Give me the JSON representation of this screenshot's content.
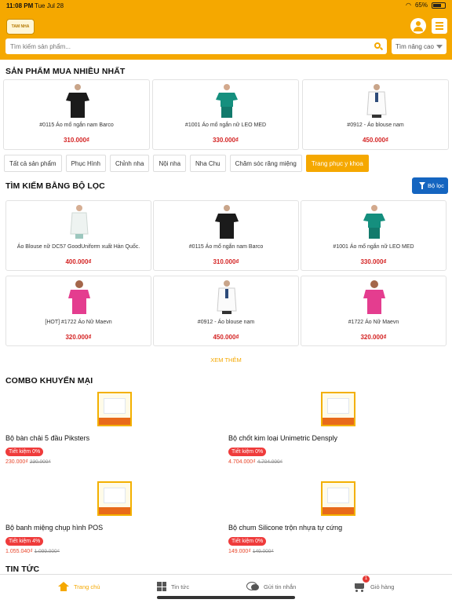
{
  "status_bar": {
    "time": "11:08 PM",
    "date": "Tue Jul 28",
    "battery": "65%"
  },
  "header": {
    "logo_text": "TAM NHA",
    "search_placeholder": "Tìm kiếm sản phẩm...",
    "advanced_label": "Tìm nâng cao"
  },
  "best_sellers": {
    "title": "SẢN PHẨM MUA NHIỀU NHẤT",
    "items": [
      {
        "name": "#0115 Áo mổ ngắn nam Barco",
        "price": "310.000₫"
      },
      {
        "name": "#1001 Áo mổ  ngắn nữ LEO MED",
        "price": "330.000₫"
      },
      {
        "name": "#0912 - Áo blouse nam",
        "price": "450.000₫"
      }
    ]
  },
  "categories": [
    "Tất cả sản phẩm",
    "Phục Hình",
    "Chỉnh nha",
    "Nội nha",
    "Nha Chu",
    "Chăm sóc răng miệng",
    "Trang phục y khoa"
  ],
  "filter_section": {
    "title": "TÌM KIẾM BẰNG BỘ LỌC",
    "filter_button": "Bộ lọc",
    "items": [
      {
        "name": "Áo Blouse nữ DC57 GoodUniform xuất Hàn Quốc.",
        "price": "400.000₫"
      },
      {
        "name": "#0115 Áo mổ ngắn nam Barco",
        "price": "310.000₫"
      },
      {
        "name": "#1001 Áo mổ  ngắn nữ LEO MED",
        "price": "330.000₫"
      },
      {
        "name": "[HOT] #1722 Áo Nữ Maevn",
        "price": "320.000₫"
      },
      {
        "name": "#0912 - Áo blouse nam",
        "price": "450.000₫"
      },
      {
        "name": "#1722 Áo Nữ Maevn",
        "price": "320.000₫"
      }
    ],
    "more_label": "XEM THÊM"
  },
  "combos": {
    "title": "COMBO KHUYẾN MẠI",
    "items": [
      {
        "name": "Bộ bàn chải 5 đầu Piksters",
        "saving": "Tiết kiệm 0%",
        "price": "230.000₫",
        "old_price": "230.000₫"
      },
      {
        "name": "Bộ chốt kim loại Unimetric Densply",
        "saving": "Tiết kiệm 0%",
        "price": "4.704.000₫",
        "old_price": "4.704.000₫"
      },
      {
        "name": "Bộ banh miệng chụp hình POS",
        "saving": "Tiết kiệm 4%",
        "price": "1.055.040₫",
        "old_price": "1.099.000₫"
      },
      {
        "name": "Bộ chum Silicone trộn nhựa tự cứng",
        "saving": "Tiết kiệm 0%",
        "price": "149.000₫",
        "old_price": "149.000₫"
      }
    ]
  },
  "news": {
    "title": "TIN TỨC"
  },
  "bottom_nav": {
    "items": [
      "Trang chủ",
      "Tin tức",
      "Gửi tin nhắn",
      "Giỏ hàng"
    ],
    "cart_count": "1"
  },
  "colors": {
    "brand": "#f5a800",
    "price": "#d42323",
    "filter_button": "#1565c0"
  }
}
